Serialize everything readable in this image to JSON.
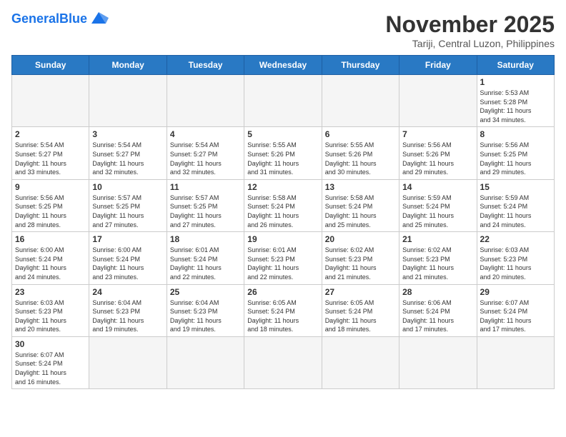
{
  "header": {
    "logo_general": "General",
    "logo_blue": "Blue",
    "month_title": "November 2025",
    "location": "Tariji, Central Luzon, Philippines"
  },
  "weekdays": [
    "Sunday",
    "Monday",
    "Tuesday",
    "Wednesday",
    "Thursday",
    "Friday",
    "Saturday"
  ],
  "weeks": [
    [
      {
        "day": "",
        "info": ""
      },
      {
        "day": "",
        "info": ""
      },
      {
        "day": "",
        "info": ""
      },
      {
        "day": "",
        "info": ""
      },
      {
        "day": "",
        "info": ""
      },
      {
        "day": "",
        "info": ""
      },
      {
        "day": "1",
        "info": "Sunrise: 5:53 AM\nSunset: 5:28 PM\nDaylight: 11 hours\nand 34 minutes."
      }
    ],
    [
      {
        "day": "2",
        "info": "Sunrise: 5:54 AM\nSunset: 5:27 PM\nDaylight: 11 hours\nand 33 minutes."
      },
      {
        "day": "3",
        "info": "Sunrise: 5:54 AM\nSunset: 5:27 PM\nDaylight: 11 hours\nand 32 minutes."
      },
      {
        "day": "4",
        "info": "Sunrise: 5:54 AM\nSunset: 5:27 PM\nDaylight: 11 hours\nand 32 minutes."
      },
      {
        "day": "5",
        "info": "Sunrise: 5:55 AM\nSunset: 5:26 PM\nDaylight: 11 hours\nand 31 minutes."
      },
      {
        "day": "6",
        "info": "Sunrise: 5:55 AM\nSunset: 5:26 PM\nDaylight: 11 hours\nand 30 minutes."
      },
      {
        "day": "7",
        "info": "Sunrise: 5:56 AM\nSunset: 5:26 PM\nDaylight: 11 hours\nand 29 minutes."
      },
      {
        "day": "8",
        "info": "Sunrise: 5:56 AM\nSunset: 5:25 PM\nDaylight: 11 hours\nand 29 minutes."
      }
    ],
    [
      {
        "day": "9",
        "info": "Sunrise: 5:56 AM\nSunset: 5:25 PM\nDaylight: 11 hours\nand 28 minutes."
      },
      {
        "day": "10",
        "info": "Sunrise: 5:57 AM\nSunset: 5:25 PM\nDaylight: 11 hours\nand 27 minutes."
      },
      {
        "day": "11",
        "info": "Sunrise: 5:57 AM\nSunset: 5:25 PM\nDaylight: 11 hours\nand 27 minutes."
      },
      {
        "day": "12",
        "info": "Sunrise: 5:58 AM\nSunset: 5:24 PM\nDaylight: 11 hours\nand 26 minutes."
      },
      {
        "day": "13",
        "info": "Sunrise: 5:58 AM\nSunset: 5:24 PM\nDaylight: 11 hours\nand 25 minutes."
      },
      {
        "day": "14",
        "info": "Sunrise: 5:59 AM\nSunset: 5:24 PM\nDaylight: 11 hours\nand 25 minutes."
      },
      {
        "day": "15",
        "info": "Sunrise: 5:59 AM\nSunset: 5:24 PM\nDaylight: 11 hours\nand 24 minutes."
      }
    ],
    [
      {
        "day": "16",
        "info": "Sunrise: 6:00 AM\nSunset: 5:24 PM\nDaylight: 11 hours\nand 24 minutes."
      },
      {
        "day": "17",
        "info": "Sunrise: 6:00 AM\nSunset: 5:24 PM\nDaylight: 11 hours\nand 23 minutes."
      },
      {
        "day": "18",
        "info": "Sunrise: 6:01 AM\nSunset: 5:24 PM\nDaylight: 11 hours\nand 22 minutes."
      },
      {
        "day": "19",
        "info": "Sunrise: 6:01 AM\nSunset: 5:23 PM\nDaylight: 11 hours\nand 22 minutes."
      },
      {
        "day": "20",
        "info": "Sunrise: 6:02 AM\nSunset: 5:23 PM\nDaylight: 11 hours\nand 21 minutes."
      },
      {
        "day": "21",
        "info": "Sunrise: 6:02 AM\nSunset: 5:23 PM\nDaylight: 11 hours\nand 21 minutes."
      },
      {
        "day": "22",
        "info": "Sunrise: 6:03 AM\nSunset: 5:23 PM\nDaylight: 11 hours\nand 20 minutes."
      }
    ],
    [
      {
        "day": "23",
        "info": "Sunrise: 6:03 AM\nSunset: 5:23 PM\nDaylight: 11 hours\nand 20 minutes."
      },
      {
        "day": "24",
        "info": "Sunrise: 6:04 AM\nSunset: 5:23 PM\nDaylight: 11 hours\nand 19 minutes."
      },
      {
        "day": "25",
        "info": "Sunrise: 6:04 AM\nSunset: 5:23 PM\nDaylight: 11 hours\nand 19 minutes."
      },
      {
        "day": "26",
        "info": "Sunrise: 6:05 AM\nSunset: 5:24 PM\nDaylight: 11 hours\nand 18 minutes."
      },
      {
        "day": "27",
        "info": "Sunrise: 6:05 AM\nSunset: 5:24 PM\nDaylight: 11 hours\nand 18 minutes."
      },
      {
        "day": "28",
        "info": "Sunrise: 6:06 AM\nSunset: 5:24 PM\nDaylight: 11 hours\nand 17 minutes."
      },
      {
        "day": "29",
        "info": "Sunrise: 6:07 AM\nSunset: 5:24 PM\nDaylight: 11 hours\nand 17 minutes."
      }
    ],
    [
      {
        "day": "30",
        "info": "Sunrise: 6:07 AM\nSunset: 5:24 PM\nDaylight: 11 hours\nand 16 minutes."
      },
      {
        "day": "",
        "info": ""
      },
      {
        "day": "",
        "info": ""
      },
      {
        "day": "",
        "info": ""
      },
      {
        "day": "",
        "info": ""
      },
      {
        "day": "",
        "info": ""
      },
      {
        "day": "",
        "info": ""
      }
    ]
  ]
}
